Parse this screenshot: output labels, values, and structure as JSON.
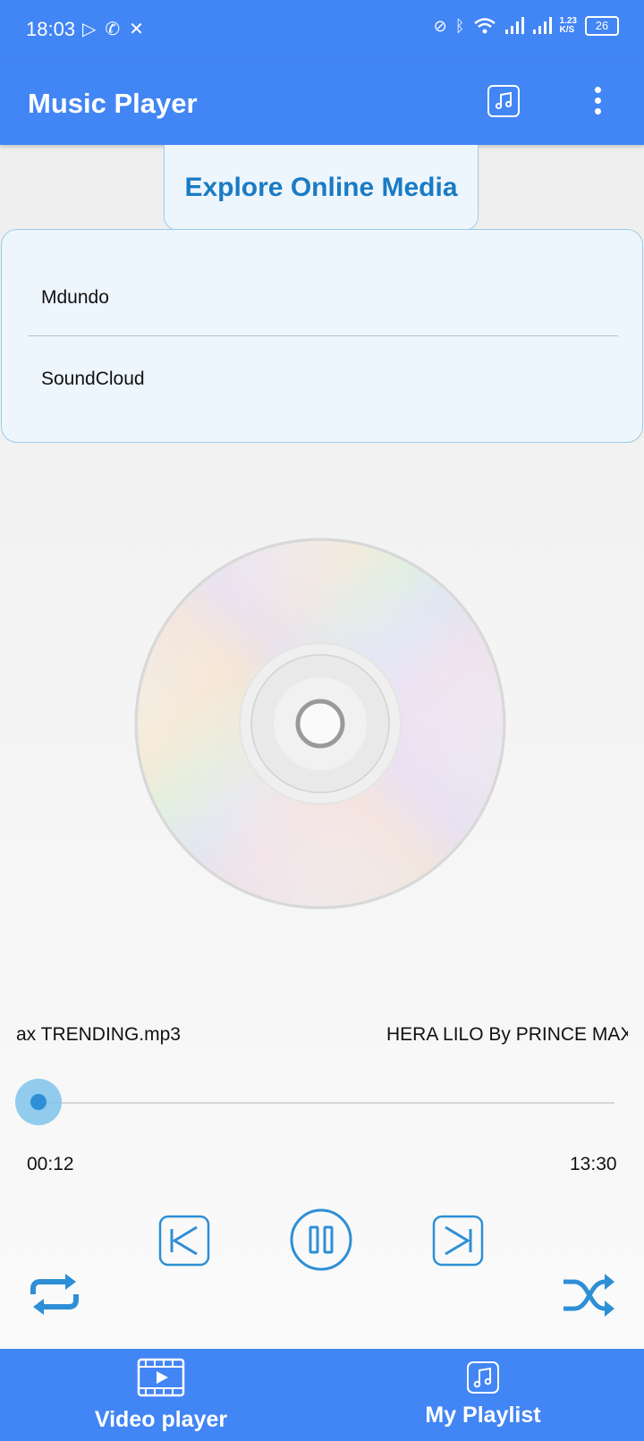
{
  "status_bar": {
    "time": "18:03",
    "net_speed_top": "1.23",
    "net_speed_bottom": "K/S",
    "battery": "26"
  },
  "app_bar": {
    "title": "Music Player",
    "music_icon": "music-note-icon",
    "menu_icon": "more-vert-icon"
  },
  "explore": {
    "title": "Explore Online Media",
    "items": [
      {
        "label": "Mdundo"
      },
      {
        "label": "SoundCloud"
      }
    ]
  },
  "player": {
    "track_left_text": "ax TRENDING.mp3",
    "track_right_text": "HERA LILO By PRINCE MAX",
    "current_time": "00:12",
    "total_time": "13:30",
    "progress_fraction": 0.015,
    "state": "playing"
  },
  "bottom_nav": {
    "items": [
      {
        "label": "Video player",
        "icon": "video-icon"
      },
      {
        "label": "My Playlist",
        "icon": "music-note-icon"
      }
    ]
  },
  "colors": {
    "primary": "#4285f4",
    "accent": "#1a7bc4",
    "panel_bg": "#eef6fd",
    "panel_border": "#9ccbe6",
    "controls": "#2e8fd6"
  }
}
